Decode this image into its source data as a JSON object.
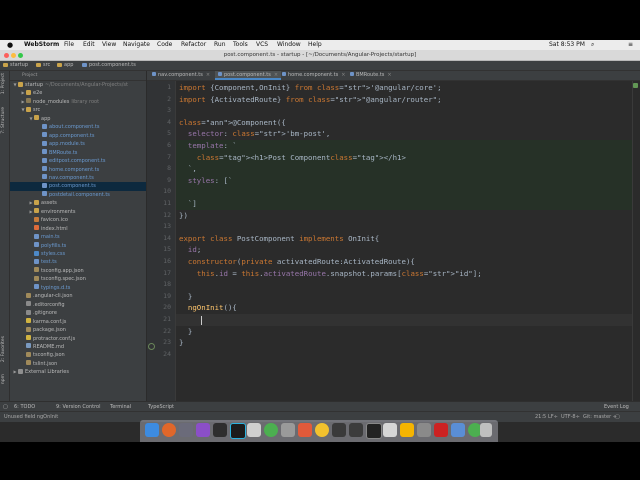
{
  "menubar": {
    "app_name": "WebStorm",
    "items": [
      "File",
      "Edit",
      "View",
      "Navigate",
      "Code",
      "Refactor",
      "Run",
      "Tools",
      "VCS",
      "Window",
      "Help"
    ],
    "clock": "Sat 8:53 PM"
  },
  "window": {
    "title": "post.component.ts - startup - [~/Documents/Angular-Projects/startup]"
  },
  "breadcrumbs": [
    "startup",
    "src",
    "app",
    "post.component.ts"
  ],
  "project_panel": {
    "header": "Project",
    "tree": [
      {
        "label": "startup",
        "aux": "~/Documents/Angular-Projects/st",
        "depth": 0,
        "arrow": "▼",
        "kind": "folder"
      },
      {
        "label": "e2e",
        "aux": "",
        "depth": 1,
        "arrow": "▶",
        "kind": "folder"
      },
      {
        "label": "node_modules",
        "aux": "library root",
        "depth": 1,
        "arrow": "▶",
        "kind": "folder-dark"
      },
      {
        "label": "src",
        "aux": "",
        "depth": 1,
        "arrow": "▼",
        "kind": "folder"
      },
      {
        "label": "app",
        "aux": "",
        "depth": 2,
        "arrow": "▼",
        "kind": "folder"
      },
      {
        "label": "about.component.ts",
        "aux": "",
        "depth": 3,
        "arrow": "",
        "kind": "ts"
      },
      {
        "label": "app.component.ts",
        "aux": "",
        "depth": 3,
        "arrow": "",
        "kind": "ts"
      },
      {
        "label": "app.module.ts",
        "aux": "",
        "depth": 3,
        "arrow": "",
        "kind": "ts"
      },
      {
        "label": "BMRoute.ts",
        "aux": "",
        "depth": 3,
        "arrow": "",
        "kind": "ts"
      },
      {
        "label": "editpost.component.ts",
        "aux": "",
        "depth": 3,
        "arrow": "",
        "kind": "ts"
      },
      {
        "label": "home.component.ts",
        "aux": "",
        "depth": 3,
        "arrow": "",
        "kind": "ts"
      },
      {
        "label": "nav.component.ts",
        "aux": "",
        "depth": 3,
        "arrow": "",
        "kind": "ts"
      },
      {
        "label": "post.component.ts",
        "aux": "",
        "depth": 3,
        "arrow": "",
        "kind": "ts",
        "selected": true
      },
      {
        "label": "postdetail.component.ts",
        "aux": "",
        "depth": 3,
        "arrow": "",
        "kind": "ts"
      },
      {
        "label": "assets",
        "aux": "",
        "depth": 2,
        "arrow": "▶",
        "kind": "folder"
      },
      {
        "label": "environments",
        "aux": "",
        "depth": 2,
        "arrow": "▶",
        "kind": "folder"
      },
      {
        "label": "favicon.ico",
        "aux": "",
        "depth": 2,
        "arrow": "",
        "kind": "img"
      },
      {
        "label": "index.html",
        "aux": "",
        "depth": 2,
        "arrow": "",
        "kind": "html"
      },
      {
        "label": "main.ts",
        "aux": "",
        "depth": 2,
        "arrow": "",
        "kind": "ts"
      },
      {
        "label": "polyfills.ts",
        "aux": "",
        "depth": 2,
        "arrow": "",
        "kind": "ts"
      },
      {
        "label": "styles.css",
        "aux": "",
        "depth": 2,
        "arrow": "",
        "kind": "css"
      },
      {
        "label": "test.ts",
        "aux": "",
        "depth": 2,
        "arrow": "",
        "kind": "ts"
      },
      {
        "label": "tsconfig.app.json",
        "aux": "",
        "depth": 2,
        "arrow": "",
        "kind": "json"
      },
      {
        "label": "tsconfig.spec.json",
        "aux": "",
        "depth": 2,
        "arrow": "",
        "kind": "json"
      },
      {
        "label": "typings.d.ts",
        "aux": "",
        "depth": 2,
        "arrow": "",
        "kind": "ts"
      },
      {
        "label": ".angular-cli.json",
        "aux": "",
        "depth": 1,
        "arrow": "",
        "kind": "json"
      },
      {
        "label": ".editorconfig",
        "aux": "",
        "depth": 1,
        "arrow": "",
        "kind": "cfg"
      },
      {
        "label": ".gitignore",
        "aux": "",
        "depth": 1,
        "arrow": "",
        "kind": "cfg"
      },
      {
        "label": "karma.conf.js",
        "aux": "",
        "depth": 1,
        "arrow": "",
        "kind": "js"
      },
      {
        "label": "package.json",
        "aux": "",
        "depth": 1,
        "arrow": "",
        "kind": "json"
      },
      {
        "label": "protractor.conf.js",
        "aux": "",
        "depth": 1,
        "arrow": "",
        "kind": "js"
      },
      {
        "label": "README.md",
        "aux": "",
        "depth": 1,
        "arrow": "",
        "kind": "md"
      },
      {
        "label": "tsconfig.json",
        "aux": "",
        "depth": 1,
        "arrow": "",
        "kind": "json"
      },
      {
        "label": "tslint.json",
        "aux": "",
        "depth": 1,
        "arrow": "",
        "kind": "json"
      },
      {
        "label": "External Libraries",
        "aux": "",
        "depth": 0,
        "arrow": "▶",
        "kind": "lib"
      }
    ]
  },
  "left_tool_labels": [
    "1: Project",
    "7: Structure",
    "2: Favorites",
    "npm"
  ],
  "tabs": [
    {
      "label": "nav.component.ts",
      "active": false
    },
    {
      "label": "post.component.ts",
      "active": true
    },
    {
      "label": "home.component.ts",
      "active": false
    },
    {
      "label": "BMRoute.ts",
      "active": false
    }
  ],
  "editor": {
    "lines": [
      {
        "n": "1",
        "t": "import {Component,OnInit} from '@angular/core';"
      },
      {
        "n": "2",
        "t": "import {ActivatedRoute} from \"@angular/router\";"
      },
      {
        "n": "3",
        "t": ""
      },
      {
        "n": "4",
        "t": "@Component({"
      },
      {
        "n": "5",
        "t": "  selector: 'bm-post',"
      },
      {
        "n": "6",
        "t": "  template: `"
      },
      {
        "n": "7",
        "t": "    <h1>Post Component</h1>"
      },
      {
        "n": "8",
        "t": "  `,"
      },
      {
        "n": "9",
        "t": "  styles: [`"
      },
      {
        "n": "10",
        "t": ""
      },
      {
        "n": "11",
        "t": "  `]"
      },
      {
        "n": "12",
        "t": "})"
      },
      {
        "n": "13",
        "t": ""
      },
      {
        "n": "14",
        "t": "export class PostComponent implements OnInit{"
      },
      {
        "n": "15",
        "t": "  id;"
      },
      {
        "n": "16",
        "t": "  constructor(private activatedRoute:ActivatedRoute){"
      },
      {
        "n": "17",
        "t": "    this.id = this.activatedRoute.snapshot.params[\"id\"];"
      },
      {
        "n": "18",
        "t": ""
      },
      {
        "n": "19",
        "t": "  }"
      },
      {
        "n": "20",
        "t": "  ngOnInit(){"
      },
      {
        "n": "21",
        "t": ""
      },
      {
        "n": "22",
        "t": "  }"
      },
      {
        "n": "23",
        "t": "}"
      },
      {
        "n": "24",
        "t": ""
      }
    ]
  },
  "bottom_tools": [
    "6: TODO",
    "9: Version Control",
    "Terminal",
    "TypeScript"
  ],
  "event_log": "Event Log",
  "status": {
    "message": "Unused field ngOnInit",
    "position": "21:5",
    "line_sep": "LF÷",
    "encoding": "UTF-8÷",
    "git": "Git: master ÷"
  },
  "colors": {
    "editor_bg": "#2b2b2b",
    "keyword": "#cc7832",
    "string": "#6a8759",
    "annotation": "#bbb529",
    "field": "#9876aa",
    "selection": "#0d293e"
  }
}
